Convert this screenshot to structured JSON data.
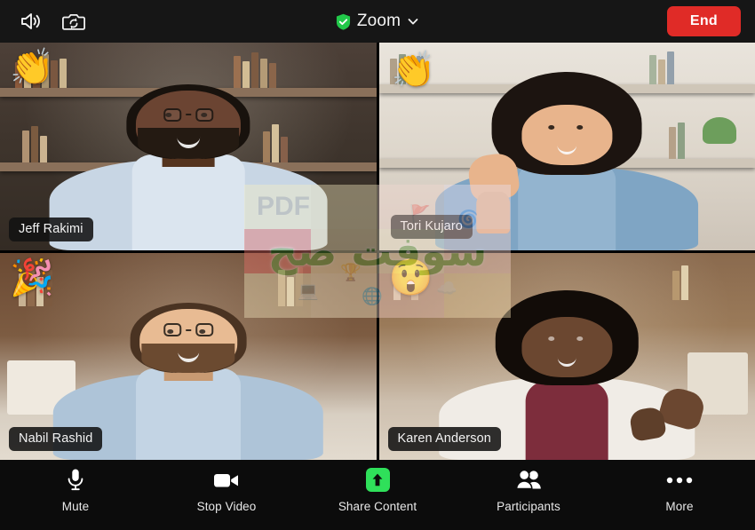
{
  "topbar": {
    "speaker_icon": "speaker-volume-icon",
    "camera_switch_icon": "camera-switch-icon",
    "title": "Zoom",
    "shield_icon": "green-shield-check-icon",
    "chevron_icon": "chevron-down-icon",
    "end_label": "End"
  },
  "participants": [
    {
      "name": "Jeff Rakimi",
      "reaction": "👏",
      "reaction_name": "clapping-hands-emoji",
      "active": false,
      "skin": "#6b4432",
      "skin_dark": "#54341f",
      "shirt": "#c8d6e4",
      "hair": "#1a1410",
      "glasses": true,
      "beard": true
    },
    {
      "name": "Tori Kujaro",
      "reaction": "👏",
      "reaction_name": "clapping-hands-emoji",
      "active": true,
      "skin": "#e8b48c",
      "skin_dark": "#c99468",
      "shirt": "#7fa5c4",
      "hair": "#1c1410",
      "glasses": false,
      "beard": false
    },
    {
      "name": "Nabil Rashid",
      "reaction": "🎉",
      "reaction_name": "party-popper-emoji",
      "active": false,
      "skin": "#e8bb93",
      "skin_dark": "#c89a72",
      "shirt": "#aec4d8",
      "hair": "#4a3322",
      "glasses": true,
      "beard": true
    },
    {
      "name": "Karen Anderson",
      "reaction": "😲",
      "reaction_name": "astonished-face-emoji",
      "active": false,
      "skin": "#6b4730",
      "skin_dark": "#523424",
      "shirt": "#f0ece6",
      "hair": "#120c08",
      "glasses": false,
      "beard": false
    }
  ],
  "watermark": {
    "arabic_text": "سوفت صح",
    "pdf_text": "PDF"
  },
  "toolbar": [
    {
      "label": "Mute",
      "icon": "microphone-icon"
    },
    {
      "label": "Stop Video",
      "icon": "video-camera-icon"
    },
    {
      "label": "Share Content",
      "icon": "share-up-arrow-icon"
    },
    {
      "label": "Participants",
      "icon": "people-group-icon"
    },
    {
      "label": "More",
      "icon": "ellipsis-icon"
    }
  ],
  "colors": {
    "end_red": "#e02b27",
    "active_green": "#20e030",
    "share_green": "#2fe05a",
    "bar_dark": "#161616",
    "app_black": "#0c0c0c"
  }
}
